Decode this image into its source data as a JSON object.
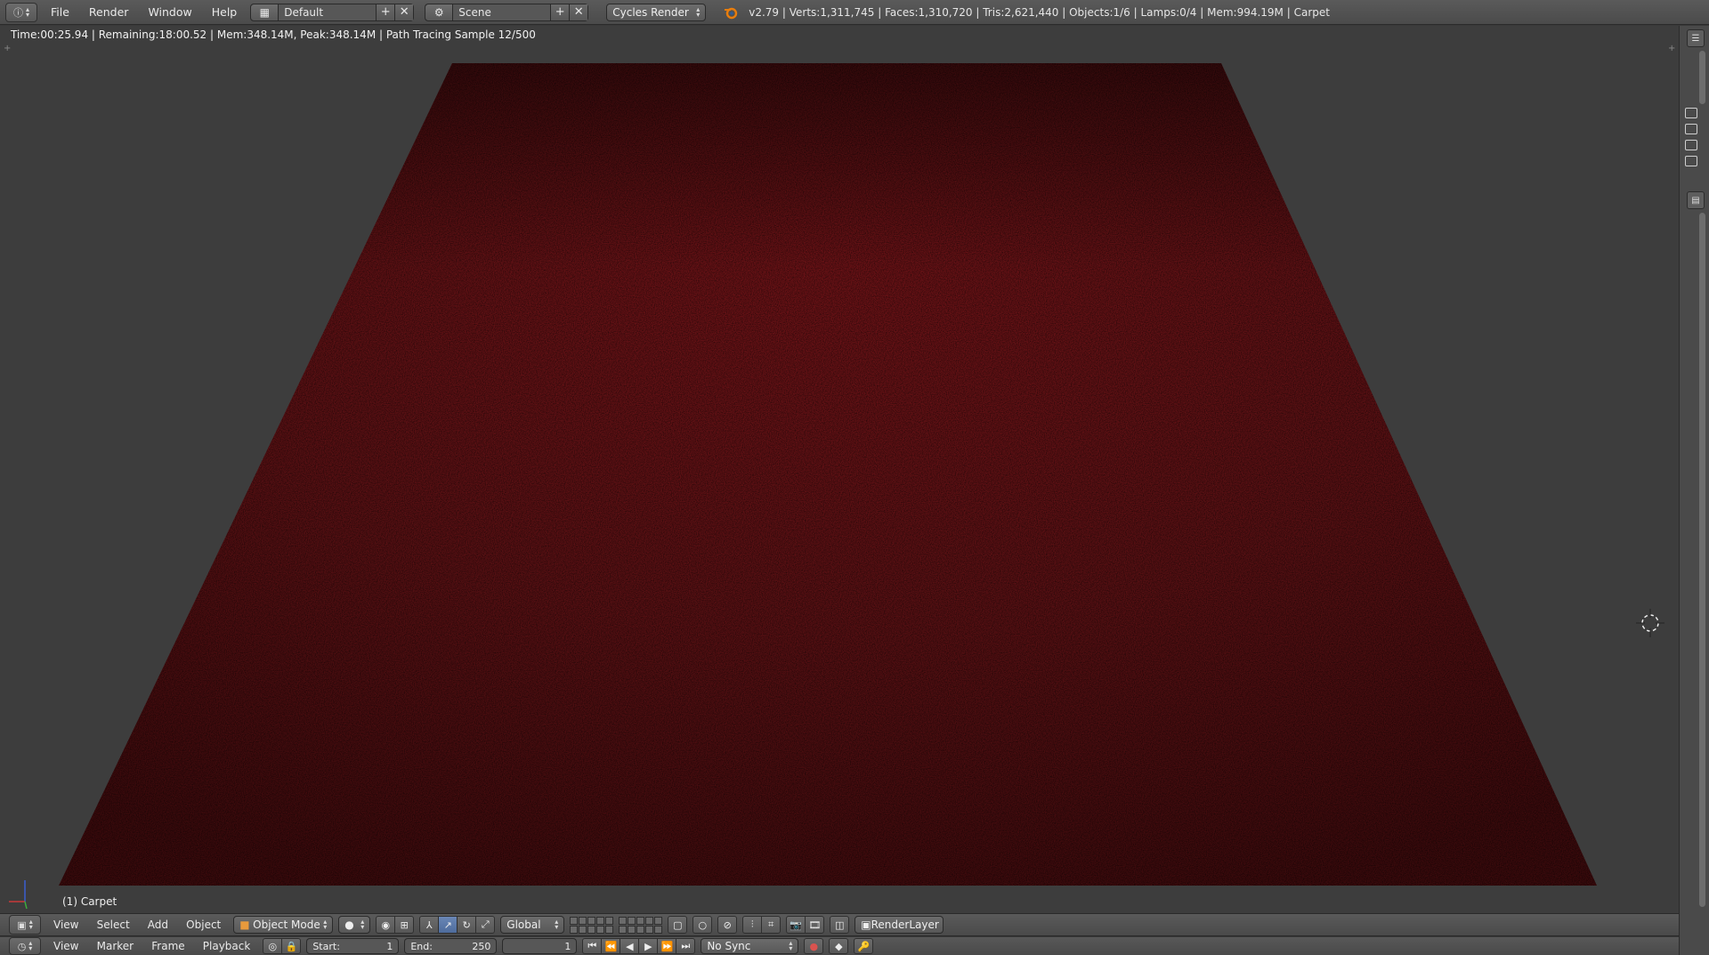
{
  "topbar": {
    "editor_icon": "info-icon",
    "menu": [
      "File",
      "Render",
      "Window",
      "Help"
    ],
    "screen_layout": "Default",
    "scene": "Scene",
    "render_engine": "Cycles Render",
    "stats": "v2.79 | Verts:1,311,745 | Faces:1,310,720 | Tris:2,621,440 | Objects:1/6 | Lamps:0/4 | Mem:994.19M | Carpet"
  },
  "viewport": {
    "render_status": "Time:00:25.94 | Remaining:18:00.52 | Mem:348.14M, Peak:348.14M | Path Tracing Sample 12/500",
    "object_label": "(1) Carpet",
    "carpet_color": "#5a0d10",
    "background_color": "#3d3d3d"
  },
  "view3d_header": {
    "menu": [
      "View",
      "Select",
      "Add",
      "Object"
    ],
    "mode": "Object Mode",
    "orientation": "Global",
    "render_layer": "RenderLayer"
  },
  "timeline_header": {
    "menu": [
      "View",
      "Marker",
      "Frame",
      "Playback"
    ],
    "start_label": "Start:",
    "start_value": "1",
    "end_label": "End:",
    "end_value": "250",
    "current_frame": "1",
    "sync": "No Sync"
  }
}
